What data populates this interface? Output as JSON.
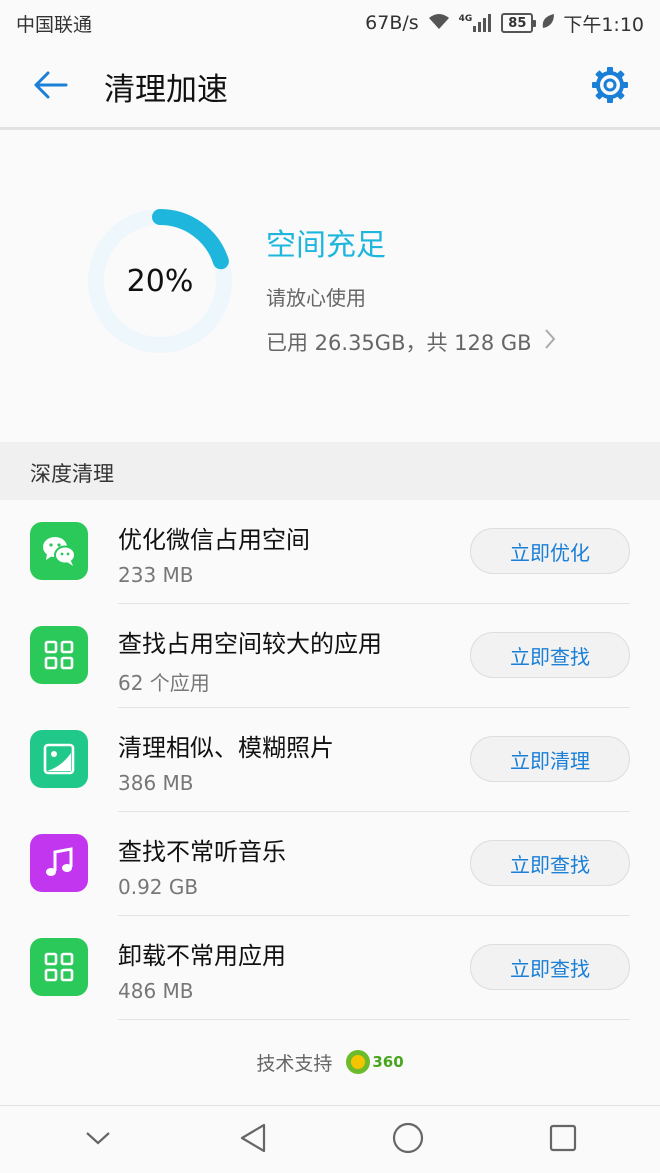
{
  "status_bar": {
    "carrier": "中国联通",
    "speed": "67B/s",
    "network": "4G",
    "battery": "85",
    "time": "下午1:10"
  },
  "app_bar": {
    "title": "清理加速",
    "back_icon": "arrow-left-icon",
    "settings_icon": "gear-icon"
  },
  "storage": {
    "percent_label": "20%",
    "percent_value": 20,
    "status": "空间充足",
    "hint": "请放心使用",
    "usage": "已用 26.35GB，共 128 GB"
  },
  "section": {
    "title": "深度清理"
  },
  "items": [
    {
      "title": "优化微信占用空间",
      "sub": "233 MB",
      "button": "立即优化",
      "icon": "wechat-icon",
      "color": "#2bc85a"
    },
    {
      "title": "查找占用空间较大的应用",
      "sub": "62 个应用",
      "button": "立即查找",
      "icon": "apps-grid-icon",
      "color": "#2bc85a"
    },
    {
      "title": "清理相似、模糊照片",
      "sub": "386 MB",
      "button": "立即清理",
      "icon": "photo-icon",
      "color": "#20c98a"
    },
    {
      "title": "查找不常听音乐",
      "sub": "0.92 GB",
      "button": "立即查找",
      "icon": "music-note-icon",
      "color": "#c236f0"
    },
    {
      "title": "卸载不常用应用",
      "sub": "486 MB",
      "button": "立即查找",
      "icon": "apps-grid-icon",
      "color": "#2bc85a"
    }
  ],
  "footer": {
    "powered_by": "技术支持",
    "brand": "360"
  },
  "colors": {
    "accent": "#1fb6dd",
    "link": "#1a7fd6"
  }
}
